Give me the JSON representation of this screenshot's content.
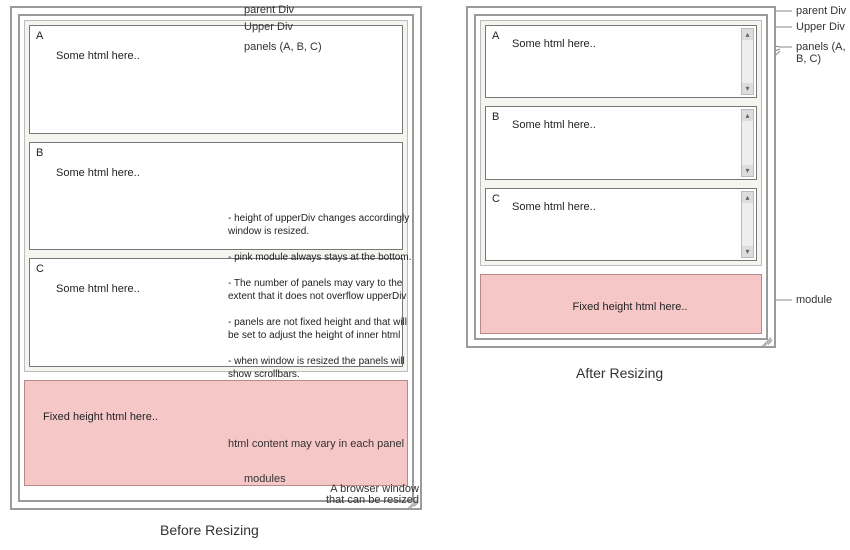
{
  "before": {
    "caption": "Before Resizing",
    "callouts": {
      "parent": "parent Div",
      "upper": "Upper Div",
      "panels": "panels  (A, B, C)",
      "modules": "modules",
      "panelNote": "html content may vary in each panel",
      "resizeNote": "A browser window\nthat can be resized"
    },
    "panels": [
      {
        "label": "A",
        "text": "Some html here.."
      },
      {
        "label": "B",
        "text": "Some html here.."
      },
      {
        "label": "C",
        "text": "Some html here.."
      }
    ],
    "module": {
      "text": "Fixed height html here.."
    },
    "notes": [
      "- height of upperDiv changes accordingly window is resized.",
      "- pink module always stays at the bottom.",
      "- The number of panels may vary to the extent that it does not overflow upperDiv",
      "- panels are not fixed height and that will be set to adjust the height of inner html",
      "- when window is resized the panels will show scrollbars."
    ]
  },
  "after": {
    "caption": "After Resizing",
    "callouts": {
      "parent": "parent Div",
      "upper": "Upper Div",
      "panels": "panels  (A, B, C)",
      "module": "module"
    },
    "panels": [
      {
        "label": "A",
        "text": "Some html here.."
      },
      {
        "label": "B",
        "text": "Some html here.."
      },
      {
        "label": "C",
        "text": "Some html here.."
      }
    ],
    "module": {
      "text": "Fixed height html here.."
    }
  }
}
